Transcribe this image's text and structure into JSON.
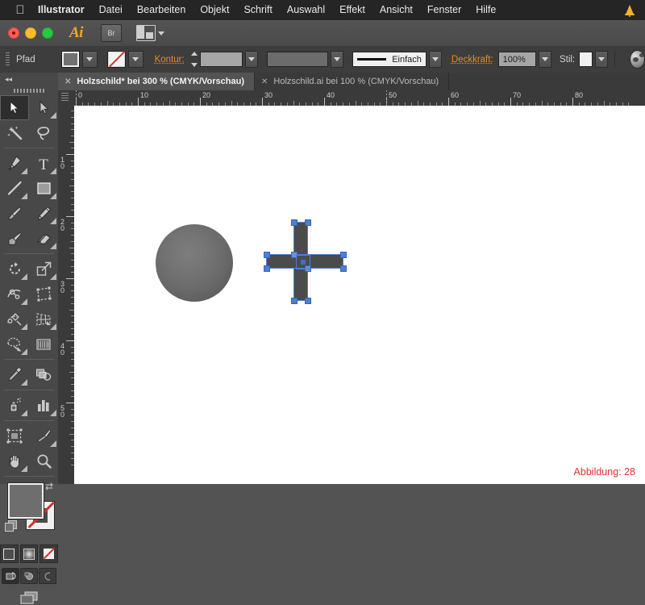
{
  "menubar": {
    "apple_icon": "apple-logo",
    "items": [
      {
        "label": "Illustrator",
        "bold": true
      },
      {
        "label": "Datei"
      },
      {
        "label": "Bearbeiten"
      },
      {
        "label": "Objekt"
      },
      {
        "label": "Schrift"
      },
      {
        "label": "Auswahl"
      },
      {
        "label": "Effekt"
      },
      {
        "label": "Ansicht"
      },
      {
        "label": "Fenster"
      },
      {
        "label": "Hilfe"
      }
    ],
    "status_icon": "bell-icon",
    "status_icon_color": "#f0b429"
  },
  "appbar": {
    "app_logo": "Ai",
    "bridge_label": "Br",
    "arrange_icon": "arrange-documents-icon",
    "window_controls": [
      "close",
      "minimize",
      "zoom"
    ]
  },
  "control_bar": {
    "object_type": "Pfad",
    "fill_label": "fill-swatch",
    "fill_color": "#717171",
    "stroke_swatch_label": "stroke-none",
    "stroke_label": "Kontur:",
    "stroke_weight_value": "",
    "stroke_profile_value": "",
    "brush_definition": "Einfach",
    "opacity_label": "Deckkraft:",
    "opacity_value": "100%",
    "style_label": "Stil:",
    "style_swatch_color": "#f0f0f0",
    "globe_icon": "render-sphere-icon"
  },
  "toolbar": {
    "collapse_icon": "double-chevron-left-icon",
    "tools": [
      {
        "name": "selection-tool",
        "active": true,
        "flyout": false
      },
      {
        "name": "direct-selection-tool",
        "active": false,
        "flyout": true
      },
      {
        "name": "magic-wand-tool",
        "active": false,
        "flyout": false
      },
      {
        "name": "lasso-tool",
        "active": false,
        "flyout": false
      },
      {
        "name": "pen-tool",
        "active": false,
        "flyout": true
      },
      {
        "name": "type-tool",
        "active": false,
        "flyout": true
      },
      {
        "name": "line-segment-tool",
        "active": false,
        "flyout": true
      },
      {
        "name": "rectangle-tool",
        "active": false,
        "flyout": true
      },
      {
        "name": "paintbrush-tool",
        "active": false,
        "flyout": false
      },
      {
        "name": "pencil-tool",
        "active": false,
        "flyout": true
      },
      {
        "name": "blob-brush-tool",
        "active": false,
        "flyout": false
      },
      {
        "name": "eraser-tool",
        "active": false,
        "flyout": true
      },
      {
        "name": "rotate-tool",
        "active": false,
        "flyout": true
      },
      {
        "name": "scale-tool",
        "active": false,
        "flyout": true
      },
      {
        "name": "width-tool",
        "active": false,
        "flyout": true
      },
      {
        "name": "free-transform-tool",
        "active": false,
        "flyout": false
      },
      {
        "name": "shape-builder-tool",
        "active": false,
        "flyout": true
      },
      {
        "name": "perspective-grid-tool",
        "active": false,
        "flyout": true
      },
      {
        "name": "mesh-tool",
        "active": false,
        "flyout": false
      },
      {
        "name": "gradient-tool",
        "active": false,
        "flyout": false
      },
      {
        "name": "eyedropper-tool",
        "active": false,
        "flyout": true
      },
      {
        "name": "blend-tool",
        "active": false,
        "flyout": false
      },
      {
        "name": "symbol-sprayer-tool",
        "active": false,
        "flyout": true
      },
      {
        "name": "column-graph-tool",
        "active": false,
        "flyout": true
      },
      {
        "name": "artboard-tool",
        "active": false,
        "flyout": false
      },
      {
        "name": "slice-tool",
        "active": false,
        "flyout": true
      },
      {
        "name": "hand-tool",
        "active": false,
        "flyout": true
      },
      {
        "name": "zoom-tool",
        "active": false,
        "flyout": false
      }
    ],
    "fill_stroke": {
      "fill_color": "#6e6e6e",
      "stroke_color": "none",
      "swap_icon": "swap-fill-stroke-icon",
      "default_icon": "default-fill-stroke-icon"
    },
    "color_modes": [
      {
        "name": "color-mode-solid",
        "active": true
      },
      {
        "name": "color-mode-gradient",
        "active": false
      },
      {
        "name": "color-mode-none",
        "active": false
      }
    ],
    "screen_modes": [
      {
        "name": "drawing-mode-normal",
        "active": true
      },
      {
        "name": "drawing-mode-behind",
        "active": false
      },
      {
        "name": "drawing-mode-inside",
        "active": false
      }
    ],
    "screen_mode_icon": "change-screen-mode-icon"
  },
  "tabs": [
    {
      "title": "Holzschild* bei 300 % (CMYK/Vorschau)",
      "active": true,
      "close_icon": "close-tab-icon"
    },
    {
      "title": "Holzschild.ai bei 100 % (CMYK/Vorschau)",
      "active": false,
      "close_icon": "close-tab-icon"
    }
  ],
  "rulers": {
    "horizontal_labels": [
      "0",
      "10",
      "20",
      "30",
      "40",
      "50",
      "60",
      "70",
      "80"
    ],
    "vertical_labels": [
      "10",
      "20",
      "30",
      "40",
      "50"
    ],
    "unit_spacing_px": 77
  },
  "canvas": {
    "background": "#ffffff",
    "objects": [
      {
        "name": "sphere-shape",
        "type": "ellipse",
        "fill_center": "#7d7d7d",
        "fill_edge": "#575757",
        "selected": false
      },
      {
        "name": "cross-shape",
        "type": "cross-path",
        "fill": "#4b4b4b",
        "selected": true,
        "selection_color": "#4f7fd0"
      }
    ]
  },
  "caption": {
    "text": "Abbildung: 28",
    "color": "#e03030"
  }
}
